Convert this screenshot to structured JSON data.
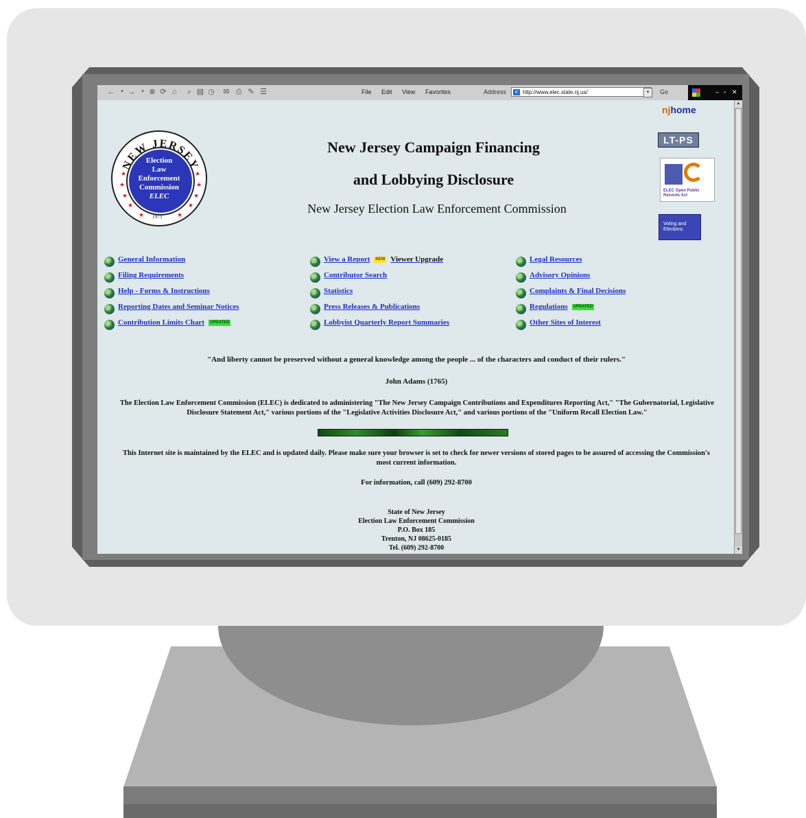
{
  "browser": {
    "menu": [
      "File",
      "Edit",
      "View",
      "Favorites"
    ],
    "address_label": "Address",
    "url": "http://www.elec.state.nj.us/",
    "go_label": "Go"
  },
  "seal": {
    "arc_text": "NEW JERSEY",
    "lines": [
      "Election",
      "Law",
      "Enforcement",
      "Commission",
      "ELEC"
    ],
    "year": "1973"
  },
  "header": {
    "title_line1": "New Jersey Campaign Financing",
    "title_line2": "and Lobbying Disclosure",
    "subtitle": "New Jersey Election Law Enforcement Commission"
  },
  "sidebar": {
    "njhome_prefix": "nj",
    "njhome_label": "home",
    "ltps_label": "LT-PS",
    "opra_label": "ELEC Open Public Records Act",
    "vote_label": "Voting and Elections"
  },
  "links": {
    "col1": [
      {
        "label": "General Information"
      },
      {
        "label": "Filing Requirements"
      },
      {
        "label": "Help - Forms & Instructions"
      },
      {
        "label": "Reporting Dates and Seminar Notices"
      },
      {
        "label": "Contribution Limits Chart",
        "badge": "UPDATED"
      }
    ],
    "col2": [
      {
        "label": "View a Report",
        "badge": "NEW",
        "extra": "Viewer Upgrade"
      },
      {
        "label": "Contributor Search"
      },
      {
        "label": "Statistics"
      },
      {
        "label": "Press Releases & Publications"
      },
      {
        "label": "Lobbyist Quarterly Report Summaries"
      }
    ],
    "col3": [
      {
        "label": "Legal Resources"
      },
      {
        "label": "Advisory Opinions"
      },
      {
        "label": "Complaints & Final Decisions"
      },
      {
        "label": "Regulations",
        "badge": "UPDATED"
      },
      {
        "label": "Other Sites of Interest"
      }
    ]
  },
  "body": {
    "quote": "\"And liberty cannot be preserved without a general knowledge among the people ... of the characters and conduct of their rulers.\"",
    "author": "John Adams (1765)",
    "mission": "The Election Law Enforcement Commission (ELEC) is dedicated to administering \"The New Jersey Campaign Contributions and Expenditures Reporting Act,\" \"The Gubernatorial, Legislative Disclosure Statement Act,\" various portions of the \"Legislative Activities Disclosure Act,\" and various portions of the \"Uniform Recall Election Law.\"",
    "maintenance": "This Internet site is maintained by the ELEC and is updated daily. Please make sure your browser is set to check for newer versions of stored pages to be assured of accessing the Commission's most current information.",
    "info": "For information, call (609) 292-8700",
    "address_lines": [
      "State of New Jersey",
      "Election Law Enforcement Commission",
      "P.O. Box 185",
      "Trenton, NJ 08625-0185",
      "Tel. (609) 292-8700"
    ]
  }
}
